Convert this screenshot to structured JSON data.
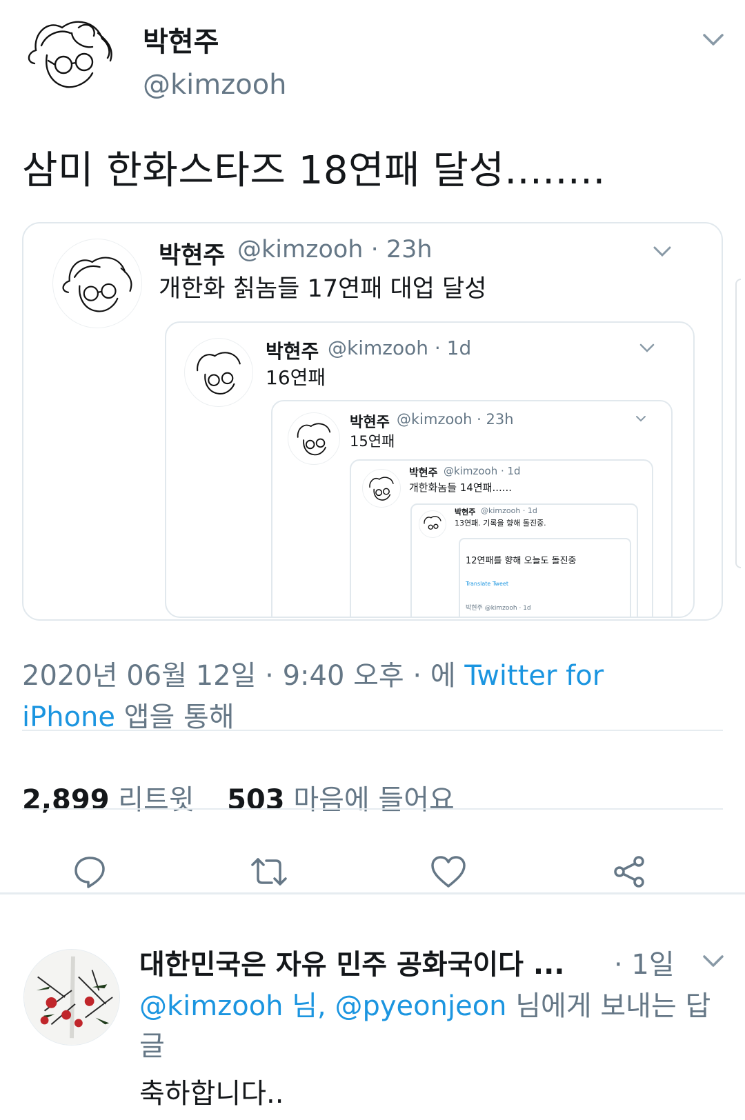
{
  "tweet": {
    "author_name": "박현주",
    "author_handle": "@kimzooh",
    "text": "삼미 한화스타즈 18연패 달성........",
    "timestamp_prefix": "2020년 06월 12일 · 9:40 오후 · 에 ",
    "source": "Twitter for iPhone",
    "timestamp_suffix": " 앱을 통해",
    "retweets_count": "2,899",
    "retweets_label": "리트윗",
    "likes_count": "503",
    "likes_label": "마음에 들어요"
  },
  "quotes": [
    {
      "name": "박현주",
      "meta": "@kimzooh · 23h",
      "text": "개한화 칡놈들 17연패 대업 달성"
    },
    {
      "name": "박현주",
      "meta": "@kimzooh · 1d",
      "text": "16연패"
    },
    {
      "name": "박현주",
      "meta": "@kimzooh · 23h",
      "text": "15연패"
    },
    {
      "name": "박현주",
      "meta": "@kimzooh · 1d",
      "text": "개한화놈들 14연패......"
    },
    {
      "name": "박현주",
      "meta": "@kimzooh · 1d",
      "text": "13연패. 기록을 향해 돌진중."
    },
    {
      "name": "",
      "meta": "",
      "text": "12연패를 향해 오늘도 돌진중",
      "translate": "Translate Tweet",
      "inner_meta": "박현주 @kimzooh · 1d"
    }
  ],
  "actions": {
    "reply": "reply-icon",
    "retweet": "retweet-icon",
    "like": "heart-icon",
    "share": "share-icon"
  },
  "reply": {
    "name": "대한민국은 자유 민주 공화국이다 ...",
    "time": "· 1일",
    "replying_prefix": "",
    "mention1": "@kimzooh 님, ",
    "mention2": "@pyeonjeon",
    "replying_suffix": " 님에게 보내는 답글",
    "text": "축하합니다.."
  },
  "colors": {
    "link": "#1b95e0",
    "muted": "#657786",
    "border": "#e1e8ed"
  }
}
